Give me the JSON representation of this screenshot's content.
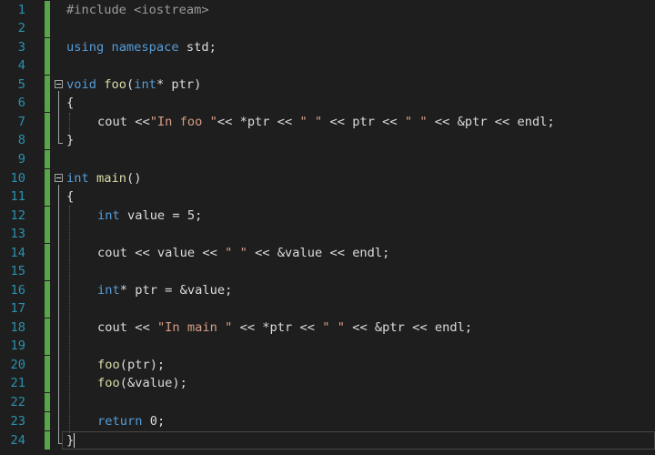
{
  "editor": {
    "line_numbers": [
      "1",
      "2",
      "3",
      "4",
      "5",
      "6",
      "7",
      "8",
      "9",
      "10",
      "11",
      "12",
      "13",
      "14",
      "15",
      "16",
      "17",
      "18",
      "19",
      "20",
      "21",
      "22",
      "23",
      "24"
    ],
    "code": {
      "l1_pp": "#include <iostream>",
      "l3_kw1": "using",
      "l3_kw2": "namespace",
      "l3_rest": " std;",
      "l5_kw": "void",
      "l5_fn": "foo",
      "l5_p1": "(",
      "l5_kw2": "int",
      "l5_p2": "* ptr)",
      "l6": "{",
      "l7_a": "cout <<",
      "l7_s1": "\"In foo \"",
      "l7_b": "<< *ptr << ",
      "l7_s2": "\" \"",
      "l7_c": " << ptr << ",
      "l7_s3": "\" \"",
      "l7_d": " << &ptr << endl;",
      "l8": "}",
      "l10_kw": "int",
      "l10_fn": "main",
      "l10_rest": "()",
      "l11": "{",
      "l12_kw": "int",
      "l12_rest": " value = ",
      "l12_num": "5",
      "l12_end": ";",
      "l14_a": "cout << value << ",
      "l14_s": "\" \"",
      "l14_b": " << &value << endl;",
      "l16_kw": "int",
      "l16_rest": "* ptr = &value;",
      "l18_a": "cout << ",
      "l18_s1": "\"In main \"",
      "l18_b": " << *ptr << ",
      "l18_s2": "\" \"",
      "l18_c": " << &ptr << endl;",
      "l20_fn": "foo",
      "l20_rest": "(ptr);",
      "l21_fn": "foo",
      "l21_rest": "(&value);",
      "l23_kw": "return",
      "l23_sp": " ",
      "l23_num": "0",
      "l23_end": ";",
      "l24": "}"
    }
  },
  "colors": {
    "background": "#1e1e1e",
    "line_number": "#2b91af",
    "keyword": "#569cd6",
    "string": "#d69d85",
    "function": "#dcdcaa",
    "text": "#dcdcdc",
    "preprocessor": "#9b9b9b",
    "modified_bar": "#57a64a"
  }
}
